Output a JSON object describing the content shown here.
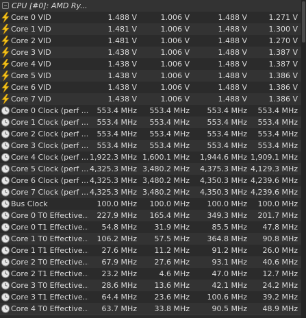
{
  "header": {
    "title": "CPU [#0]: AMD Ry..."
  },
  "rows": [
    {
      "label": "Core 0 VID",
      "icon": "lightning-bolt-icon",
      "vals": [
        "1.488 V",
        "1.006 V",
        "1.488 V",
        "1.271 V"
      ]
    },
    {
      "label": "Core 1 VID",
      "icon": "lightning-bolt-icon",
      "vals": [
        "1.481 V",
        "1.006 V",
        "1.488 V",
        "1.300 V"
      ]
    },
    {
      "label": "Core 2 VID",
      "icon": "lightning-bolt-icon",
      "vals": [
        "1.481 V",
        "1.006 V",
        "1.488 V",
        "1.270 V"
      ]
    },
    {
      "label": "Core 3 VID",
      "icon": "lightning-bolt-icon",
      "vals": [
        "1.438 V",
        "1.006 V",
        "1.488 V",
        "1.387 V"
      ]
    },
    {
      "label": "Core 4 VID",
      "icon": "lightning-bolt-icon",
      "vals": [
        "1.438 V",
        "1.006 V",
        "1.488 V",
        "1.387 V"
      ]
    },
    {
      "label": "Core 5 VID",
      "icon": "lightning-bolt-icon",
      "vals": [
        "1.438 V",
        "1.006 V",
        "1.488 V",
        "1.386 V"
      ]
    },
    {
      "label": "Core 6 VID",
      "icon": "lightning-bolt-icon",
      "vals": [
        "1.438 V",
        "1.006 V",
        "1.488 V",
        "1.386 V"
      ]
    },
    {
      "label": "Core 7 VID",
      "icon": "lightning-bolt-icon",
      "vals": [
        "1.438 V",
        "1.006 V",
        "1.488 V",
        "1.386 V"
      ]
    },
    {
      "label": "Core 0 Clock (perf ...",
      "icon": "clock-gauge-icon",
      "vals": [
        "553.4 MHz",
        "553.4 MHz",
        "553.4 MHz",
        "553.4 MHz"
      ]
    },
    {
      "label": "Core 1 Clock (perf ...",
      "icon": "clock-gauge-icon",
      "vals": [
        "553.4 MHz",
        "553.4 MHz",
        "553.4 MHz",
        "553.4 MHz"
      ]
    },
    {
      "label": "Core 2 Clock (perf ...",
      "icon": "clock-gauge-icon",
      "vals": [
        "553.4 MHz",
        "553.4 MHz",
        "553.4 MHz",
        "553.4 MHz"
      ]
    },
    {
      "label": "Core 3 Clock (perf ...",
      "icon": "clock-gauge-icon",
      "vals": [
        "553.4 MHz",
        "553.4 MHz",
        "553.4 MHz",
        "553.4 MHz"
      ]
    },
    {
      "label": "Core 4 Clock (perf ...",
      "icon": "clock-gauge-icon",
      "vals": [
        "1,922.3 MHz",
        "1,600.1 MHz",
        "1,944.6 MHz",
        "1,909.1 MHz"
      ]
    },
    {
      "label": "Core 5 Clock (perf ...",
      "icon": "clock-gauge-icon",
      "vals": [
        "4,325.3 MHz",
        "3,480.2 MHz",
        "4,375.3 MHz",
        "4,129.3 MHz"
      ]
    },
    {
      "label": "Core 6 Clock (perf ...",
      "icon": "clock-gauge-icon",
      "vals": [
        "4,325.3 MHz",
        "3,480.2 MHz",
        "4,350.3 MHz",
        "4,239.6 MHz"
      ]
    },
    {
      "label": "Core 7 Clock (perf ...",
      "icon": "clock-gauge-icon",
      "vals": [
        "4,325.3 MHz",
        "3,480.2 MHz",
        "4,350.3 MHz",
        "4,239.6 MHz"
      ]
    },
    {
      "label": "Bus Clock",
      "icon": "clock-gauge-icon",
      "vals": [
        "100.0 MHz",
        "100.0 MHz",
        "100.0 MHz",
        "100.0 MHz"
      ]
    },
    {
      "label": "Core 0 T0 Effective...",
      "icon": "clock-gauge-icon",
      "vals": [
        "227.9 MHz",
        "165.4 MHz",
        "349.3 MHz",
        "201.7 MHz"
      ]
    },
    {
      "label": "Core 0 T1 Effective...",
      "icon": "clock-gauge-icon",
      "vals": [
        "54.8 MHz",
        "31.9 MHz",
        "85.5 MHz",
        "47.8 MHz"
      ]
    },
    {
      "label": "Core 1 T0 Effective...",
      "icon": "clock-gauge-icon",
      "vals": [
        "106.2 MHz",
        "57.5 MHz",
        "364.8 MHz",
        "90.8 MHz"
      ]
    },
    {
      "label": "Core 1 T1 Effective...",
      "icon": "clock-gauge-icon",
      "vals": [
        "27.6 MHz",
        "11.2 MHz",
        "91.2 MHz",
        "26.0 MHz"
      ]
    },
    {
      "label": "Core 2 T0 Effective...",
      "icon": "clock-gauge-icon",
      "vals": [
        "67.9 MHz",
        "27.6 MHz",
        "93.1 MHz",
        "40.6 MHz"
      ]
    },
    {
      "label": "Core 2 T1 Effective...",
      "icon": "clock-gauge-icon",
      "vals": [
        "23.2 MHz",
        "4.6 MHz",
        "47.0 MHz",
        "12.7 MHz"
      ]
    },
    {
      "label": "Core 3 T0 Effective...",
      "icon": "clock-gauge-icon",
      "vals": [
        "28.6 MHz",
        "13.6 MHz",
        "42.1 MHz",
        "24.2 MHz"
      ]
    },
    {
      "label": "Core 3 T1 Effective...",
      "icon": "clock-gauge-icon",
      "vals": [
        "64.4 MHz",
        "23.6 MHz",
        "100.6 MHz",
        "39.2 MHz"
      ]
    },
    {
      "label": "Core 4 T0 Effective...",
      "icon": "clock-gauge-icon",
      "vals": [
        "63.7 MHz",
        "33.8 MHz",
        "90.5 MHz",
        "48.9 MHz"
      ]
    }
  ]
}
